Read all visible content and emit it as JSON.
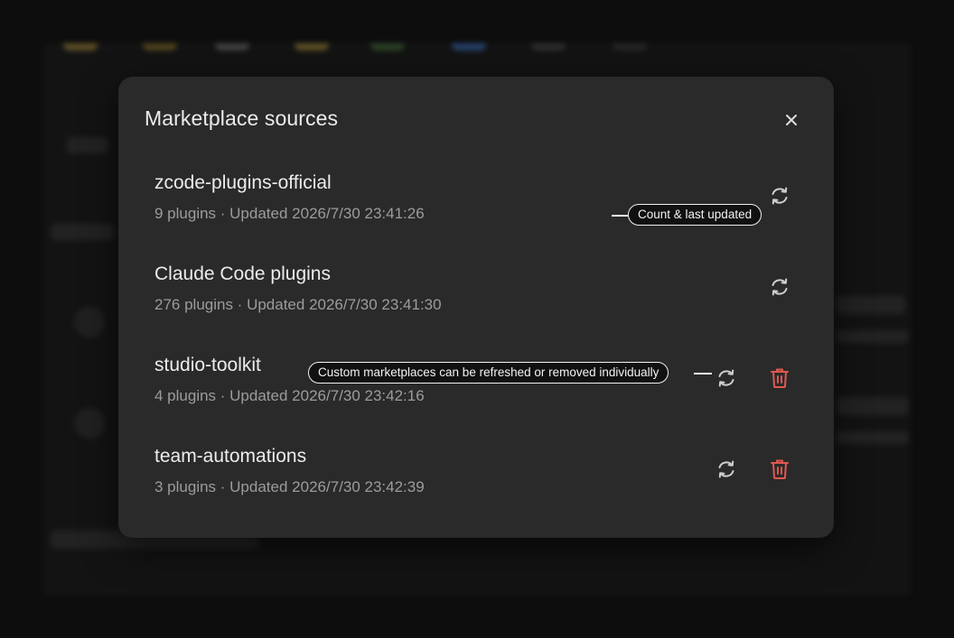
{
  "modal": {
    "title": "Marketplace sources",
    "close_icon": "close-icon"
  },
  "sources": [
    {
      "name": "zcode-plugins-official",
      "meta": "9 plugins · Updated 2026/7/30 23:41:26",
      "removable": false
    },
    {
      "name": "Claude Code plugins",
      "meta": "276 plugins · Updated 2026/7/30 23:41:30",
      "removable": false
    },
    {
      "name": "studio-toolkit",
      "meta": "4 plugins · Updated 2026/7/30 23:42:16",
      "removable": true
    },
    {
      "name": "team-automations",
      "meta": "3 plugins · Updated 2026/7/30 23:42:39",
      "removable": true
    }
  ],
  "icons": {
    "refresh": "refresh-icon",
    "delete": "trash-icon"
  },
  "annotations": {
    "count_updated": "Count & last updated",
    "custom_actions": "Custom marketplaces can be refreshed or removed individually"
  },
  "colors": {
    "modal_bg": "#2a2a2a",
    "text_primary": "#ececec",
    "text_secondary": "#9c9c9c",
    "icon": "#cfcfcf",
    "danger": "#e0584f",
    "backdrop": "#0d0d0d"
  }
}
